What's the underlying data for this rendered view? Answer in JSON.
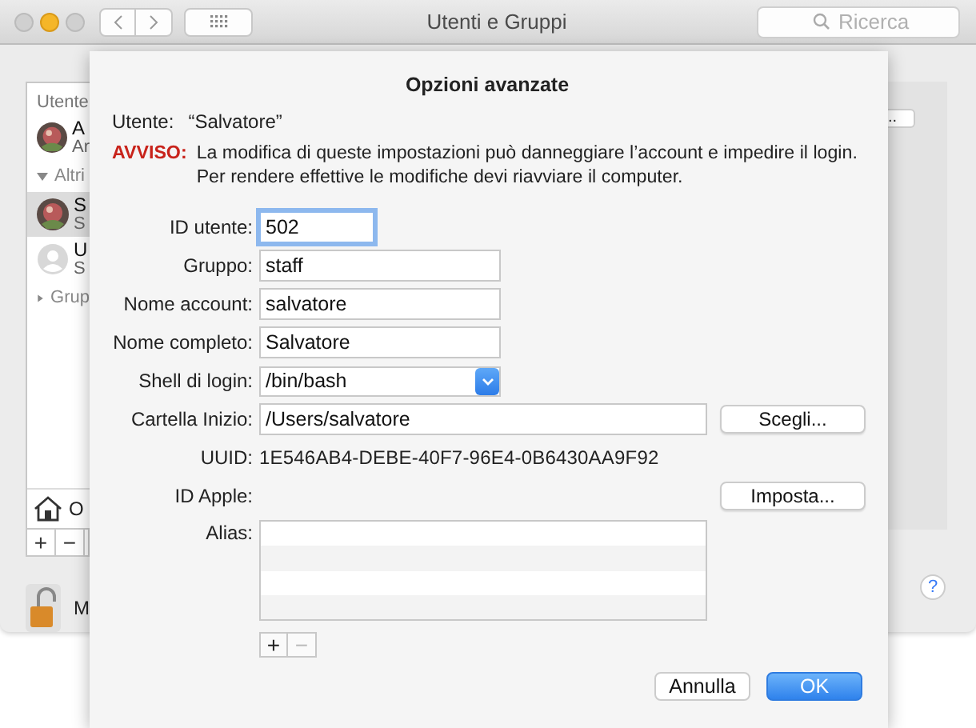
{
  "window": {
    "title": "Utenti e Gruppi",
    "search": {
      "placeholder": "Ricerca"
    }
  },
  "sidebar": {
    "header": "Utente",
    "items": [
      {
        "kind": "user",
        "name": "A",
        "subtitle": "Ar",
        "photo": true,
        "selected": false
      },
      {
        "kind": "section",
        "name": "Altri",
        "expanded": true
      },
      {
        "kind": "user",
        "name": "S",
        "subtitle": "S",
        "photo": true,
        "selected": true
      },
      {
        "kind": "user",
        "name": "U",
        "subtitle": "S",
        "photo": false,
        "selected": false
      },
      {
        "kind": "section",
        "name": "Grup",
        "expanded": false
      }
    ],
    "login_item": "O",
    "add": "+",
    "remove": "−"
  },
  "lock": {
    "label": "M"
  },
  "side_button": "..",
  "help": "?",
  "sheet": {
    "title": "Opzioni avanzate",
    "user_label": "Utente:",
    "user_value": "“Salvatore”",
    "warning_label": "AVVISO:",
    "warning": "La modifica di queste impostazioni può danneggiare l’account e impedire il login. Per rendere effettive le modifiche devi riavviare il computer.",
    "fields": [
      {
        "kind": "text",
        "label": "ID utente:",
        "value": "502",
        "focused": true
      },
      {
        "kind": "text",
        "label": "Gruppo:",
        "value": "staff",
        "focused": false
      },
      {
        "kind": "text",
        "label": "Nome account:",
        "value": "salvatore",
        "focused": false
      },
      {
        "kind": "text",
        "label": "Nome completo:",
        "value": "Salvatore",
        "focused": false
      },
      {
        "kind": "popup",
        "label": "Shell di login:",
        "value": "/bin/bash"
      },
      {
        "kind": "path",
        "label": "Cartella Inizio:",
        "value": "/Users/salvatore",
        "button": "Scegli..."
      },
      {
        "kind": "static",
        "label": "UUID:",
        "value": "1E546AB4-DEBE-40F7-96E4-0B6430AA9F92"
      },
      {
        "kind": "action",
        "label": "ID Apple:",
        "button": "Imposta..."
      },
      {
        "kind": "list",
        "label": "Alias:",
        "add": "+",
        "remove": "−",
        "remove_disabled": true
      }
    ],
    "buttons": [
      {
        "label": "Annulla",
        "default": false
      },
      {
        "label": "OK",
        "default": true
      }
    ]
  }
}
